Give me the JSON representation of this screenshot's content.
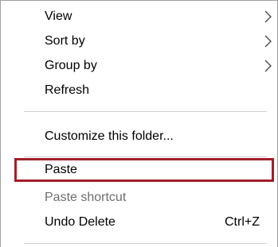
{
  "menu": {
    "items": [
      {
        "label": "View",
        "submenu": true,
        "enabled": true
      },
      {
        "label": "Sort by",
        "submenu": true,
        "enabled": true
      },
      {
        "label": "Group by",
        "submenu": true,
        "enabled": true
      },
      {
        "label": "Refresh",
        "submenu": false,
        "enabled": true
      },
      {
        "label": "Customize this folder...",
        "submenu": false,
        "enabled": true
      },
      {
        "label": "Paste",
        "submenu": false,
        "enabled": true,
        "highlighted": true
      },
      {
        "label": "Paste shortcut",
        "submenu": false,
        "enabled": false
      },
      {
        "label": "Undo Delete",
        "shortcut": "Ctrl+Z",
        "submenu": false,
        "enabled": true
      }
    ]
  },
  "colors": {
    "highlight_border": "#a31e2a",
    "disabled_text": "#6d6d6d",
    "separator": "#cfcfcf"
  },
  "icons": {
    "submenu": "chevron-right-icon"
  }
}
